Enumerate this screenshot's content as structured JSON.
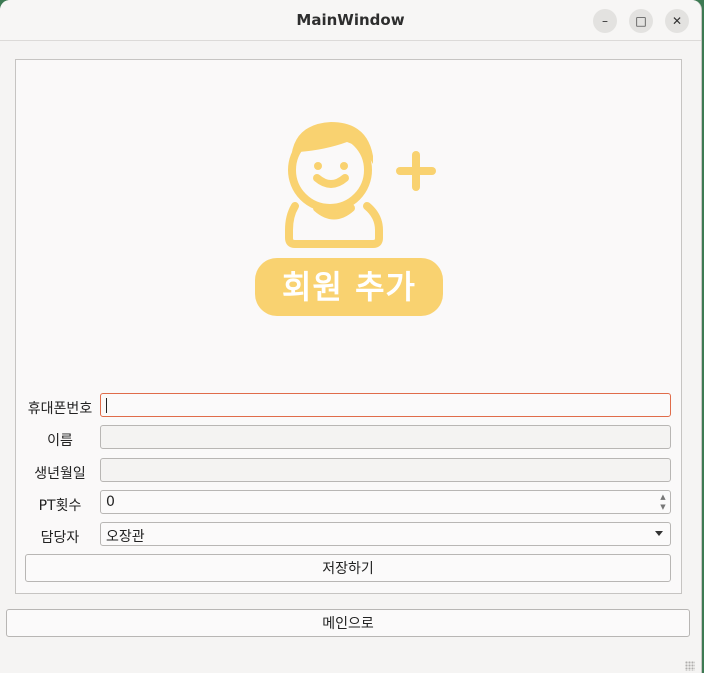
{
  "window": {
    "title": "MainWindow",
    "controls": {
      "minimize": "–",
      "maximize": "□",
      "close": "✕"
    }
  },
  "hero": {
    "icon": "add-user-icon",
    "label": "회원 추가",
    "accent": "#f9d270"
  },
  "form": {
    "phone": {
      "label": "휴대폰번호",
      "value": ""
    },
    "name": {
      "label": "이름",
      "value": ""
    },
    "birthdate": {
      "label": "생년월일",
      "value": ""
    },
    "pt_count": {
      "label": "PT횟수",
      "value": "0"
    },
    "trainer": {
      "label": "담당자",
      "selected": "오장관"
    }
  },
  "buttons": {
    "save": "저장하기",
    "main": "메인으로"
  },
  "colors": {
    "focus_border": "#e06c4a",
    "desktop": "#3d7a53"
  }
}
